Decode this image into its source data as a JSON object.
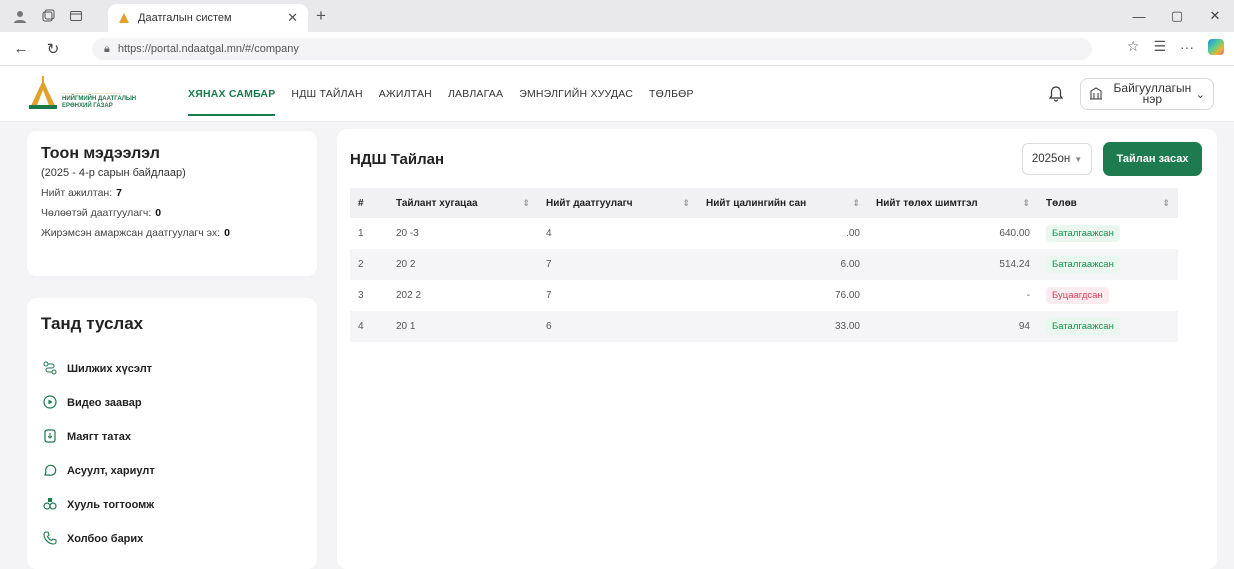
{
  "browser": {
    "tab_title": "Даатгалын систем",
    "url": "https://portal.ndaatgal.mn/#/company"
  },
  "logo": {
    "line1": "НИЙГМИЙН ДААТГАЛЫН",
    "line2": "ЕРӨНХИЙ ГАЗАР"
  },
  "nav": {
    "items": [
      {
        "label": "ХЯНАХ САМБАР",
        "active": true
      },
      {
        "label": "НДШ ТАЙЛАН",
        "active": false
      },
      {
        "label": "АЖИЛТАН",
        "active": false
      },
      {
        "label": "ЛАВЛАГАА",
        "active": false
      },
      {
        "label": "ЭМНЭЛГИЙН ХУУДАС",
        "active": false
      },
      {
        "label": "ТӨЛБӨР",
        "active": false
      }
    ],
    "org_name": "Байгууллагын нэр"
  },
  "stats": {
    "title": "Тоон мэдээлэл",
    "subtitle": "(2025 - 4-р сарын байдлаар)",
    "rows": [
      {
        "label": "Нийт ажилтан:",
        "value": "7"
      },
      {
        "label": "Чөлөөтэй даатгуулагч:",
        "value": "0"
      },
      {
        "label": "Жирэмсэн амаржсан даатгуулагч эх:",
        "value": "0"
      }
    ]
  },
  "help": {
    "title": "Танд туслах",
    "items": [
      {
        "label": "Шилжих хүсэлт",
        "icon": "route-icon"
      },
      {
        "label": "Видео заавар",
        "icon": "play-icon"
      },
      {
        "label": "Маягт татах",
        "icon": "file-download-icon"
      },
      {
        "label": "Асуулт, хариулт",
        "icon": "chat-icon"
      },
      {
        "label": "Хууль тогтоомж",
        "icon": "law-icon"
      },
      {
        "label": "Холбоо барих",
        "icon": "phone-icon"
      }
    ]
  },
  "report": {
    "title": "НДШ Тайлан",
    "year": "2025он",
    "edit_label": "Тайлан засах",
    "columns": [
      "#",
      "Тайлант хугацаа",
      "Нийт даатгуулагч",
      "Нийт цалингийн сан",
      "Нийт төлөх шимтгэл",
      "Төлөв"
    ],
    "rows": [
      {
        "no": "1",
        "period": "20  -3",
        "insured": "4",
        "salary": ".00",
        "contribution": "640.00",
        "status": "Баталгаажсан",
        "ok": true
      },
      {
        "no": "2",
        "period": "20   2",
        "insured": "7",
        "salary": "6.00",
        "contribution": "514.24",
        "status": "Баталгаажсан",
        "ok": true
      },
      {
        "no": "3",
        "period": "202 2",
        "insured": "7",
        "salary": "76.00",
        "contribution": "-",
        "status": "Буцаагдсан",
        "ok": false
      },
      {
        "no": "4",
        "period": "20   1",
        "insured": "6",
        "salary": "33.00",
        "contribution": "94",
        "status": "Баталгаажсан",
        "ok": true
      }
    ]
  },
  "colors": {
    "brand_green": "#1d7b4f",
    "ok_text": "#1a9050",
    "bad_text": "#d9425a"
  }
}
